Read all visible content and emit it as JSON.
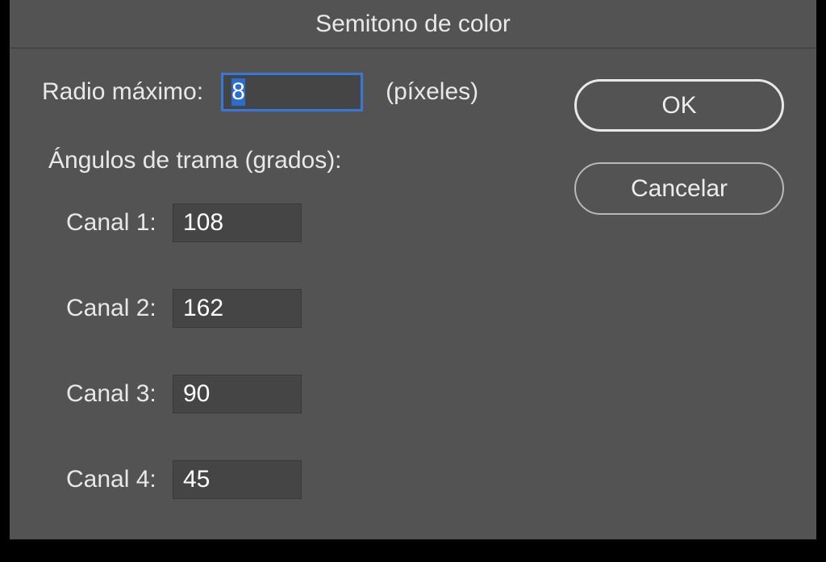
{
  "dialog": {
    "title": "Semitono de color",
    "radius_label": "Radio máximo:",
    "radius_value": "8",
    "unit_label": "(píxeles)",
    "section_title": "Ángulos de trama (grados):",
    "channels": [
      {
        "label": "Canal 1:",
        "value": "108"
      },
      {
        "label": "Canal 2:",
        "value": "162"
      },
      {
        "label": "Canal 3:",
        "value": "90"
      },
      {
        "label": "Canal 4:",
        "value": "45"
      }
    ],
    "ok_label": "OK",
    "cancel_label": "Cancelar"
  }
}
